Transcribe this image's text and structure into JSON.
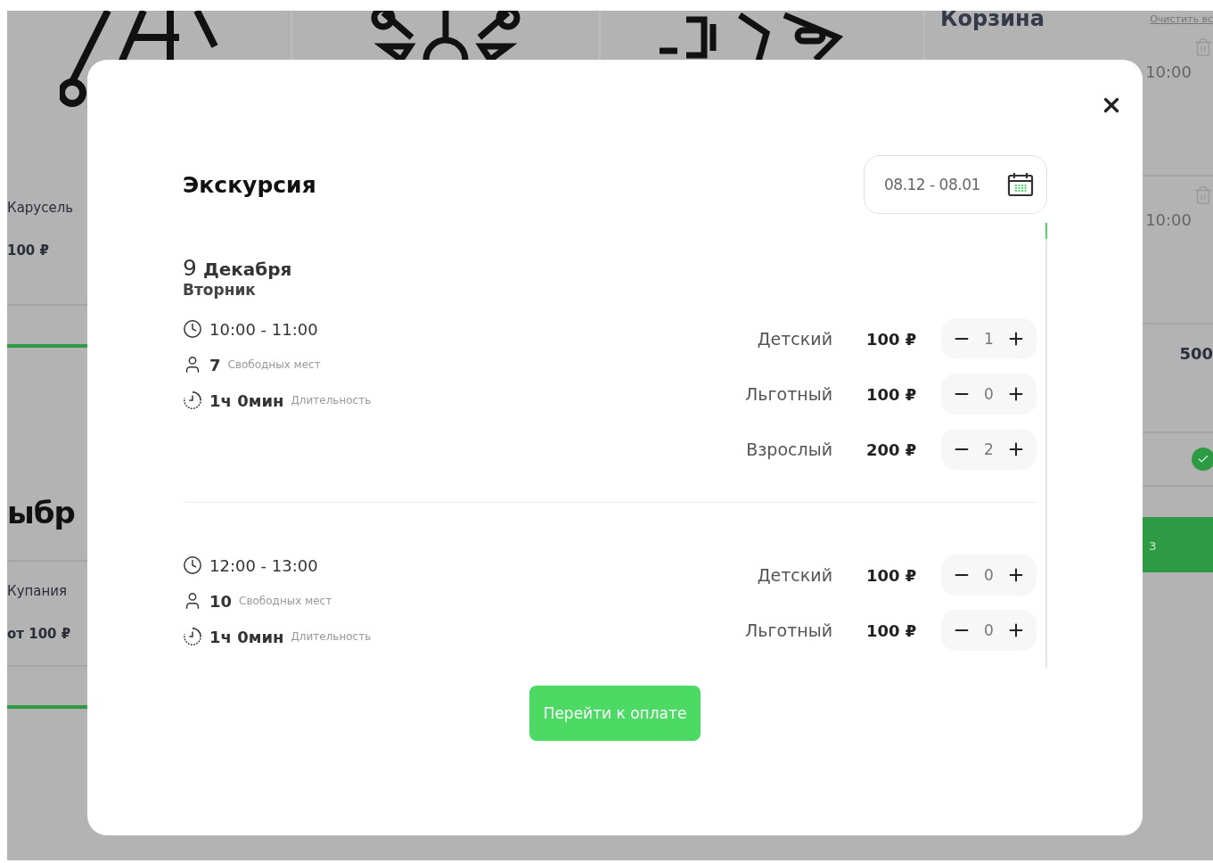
{
  "background": {
    "cards": [
      {
        "title": "Карусель",
        "price": "100 ₽"
      }
    ],
    "section_heading": "ыбр",
    "cards_2": [
      {
        "title": "Купания",
        "price": "от 100 ₽"
      }
    ],
    "cart": {
      "title": "Корзина",
      "clear_link": "Очистить вс",
      "items": [
        {
          "time": "10:00"
        },
        {
          "time": "10:00"
        }
      ],
      "total": "500",
      "confirmed": true,
      "button": "з"
    }
  },
  "modal": {
    "title": "Экскурсия",
    "date_range": "08.12 - 08.01",
    "day": {
      "number": "9",
      "month": "Декабря",
      "weekday": "Вторник"
    },
    "slots": [
      {
        "time": "10:00 - 11:00",
        "seats": "7",
        "seats_label": "Свободных мест",
        "duration": "1ч 0мин",
        "duration_label": "Длительность",
        "tickets": [
          {
            "label": "Детский",
            "price": "100 ₽",
            "count": "1"
          },
          {
            "label": "Льготный",
            "price": "100 ₽",
            "count": "0"
          },
          {
            "label": "Взрослый",
            "price": "200 ₽",
            "count": "2"
          }
        ]
      },
      {
        "time": "12:00 - 13:00",
        "seats": "10",
        "seats_label": "Свободных мест",
        "duration": "1ч 0мин",
        "duration_label": "Длительность",
        "tickets": [
          {
            "label": "Детский",
            "price": "100 ₽",
            "count": "0"
          },
          {
            "label": "Льготный",
            "price": "100 ₽",
            "count": "0"
          }
        ]
      }
    ],
    "pay_button": "Перейти к оплате"
  }
}
